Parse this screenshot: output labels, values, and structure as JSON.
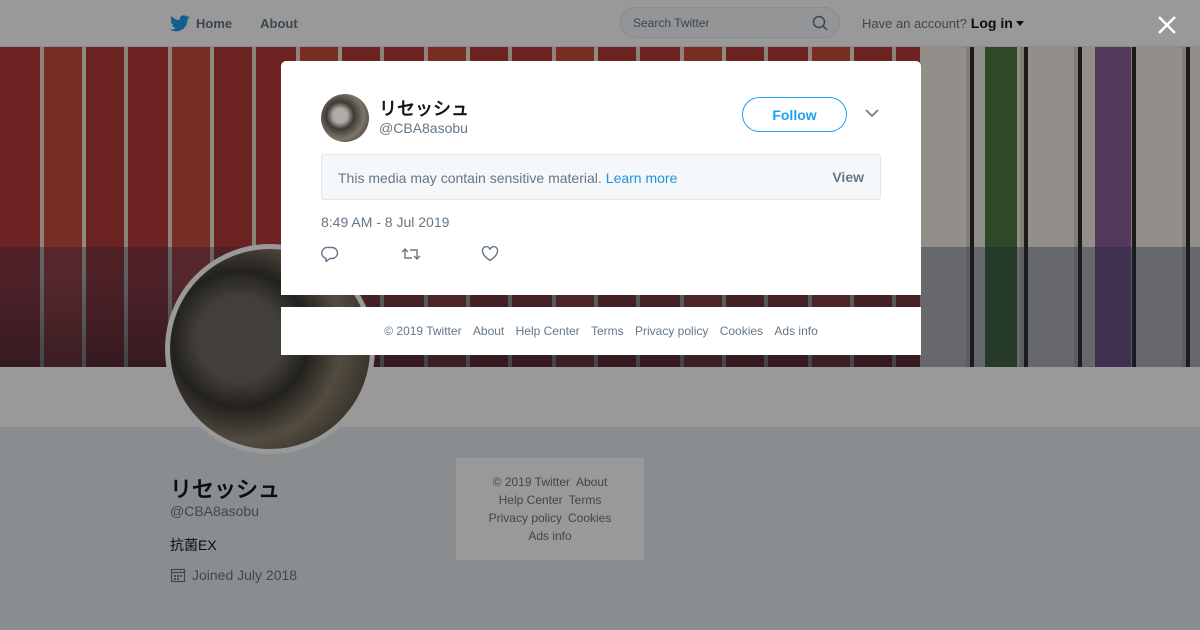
{
  "nav": {
    "home_label": "Home",
    "about_label": "About",
    "search_placeholder": "Search Twitter",
    "have_account": "Have an account?",
    "login_label": "Log in"
  },
  "profile": {
    "name": "リセッシュ",
    "handle": "@CBA8asobu",
    "bio": "抗菌EX",
    "joined": "Joined July 2018"
  },
  "side_footer": {
    "copyright": "© 2019 Twitter",
    "about": "About",
    "help_center": "Help Center",
    "terms": "Terms",
    "privacy": "Privacy policy",
    "cookies": "Cookies",
    "ads_info": "Ads info"
  },
  "tweet": {
    "author_name": "リセッシュ",
    "author_handle": "@CBA8asobu",
    "follow_label": "Follow",
    "sensitive_text": "This media may contain sensitive material.",
    "learn_more": "Learn more",
    "view_label": "View",
    "timestamp": "8:49 AM - 8 Jul 2019"
  },
  "modal_footer": {
    "copyright": "© 2019 Twitter",
    "about": "About",
    "help_center": "Help Center",
    "terms": "Terms",
    "privacy": "Privacy policy",
    "cookies": "Cookies",
    "ads_info": "Ads info"
  },
  "icons": {
    "logo": "twitter-bird-icon",
    "search": "search-icon",
    "close": "close-icon",
    "reply": "reply-icon",
    "retweet": "retweet-icon",
    "like": "heart-icon",
    "calendar": "calendar-icon"
  },
  "colors": {
    "brand": "#1da1f2",
    "link": "#1b95e0",
    "muted": "#657786"
  }
}
